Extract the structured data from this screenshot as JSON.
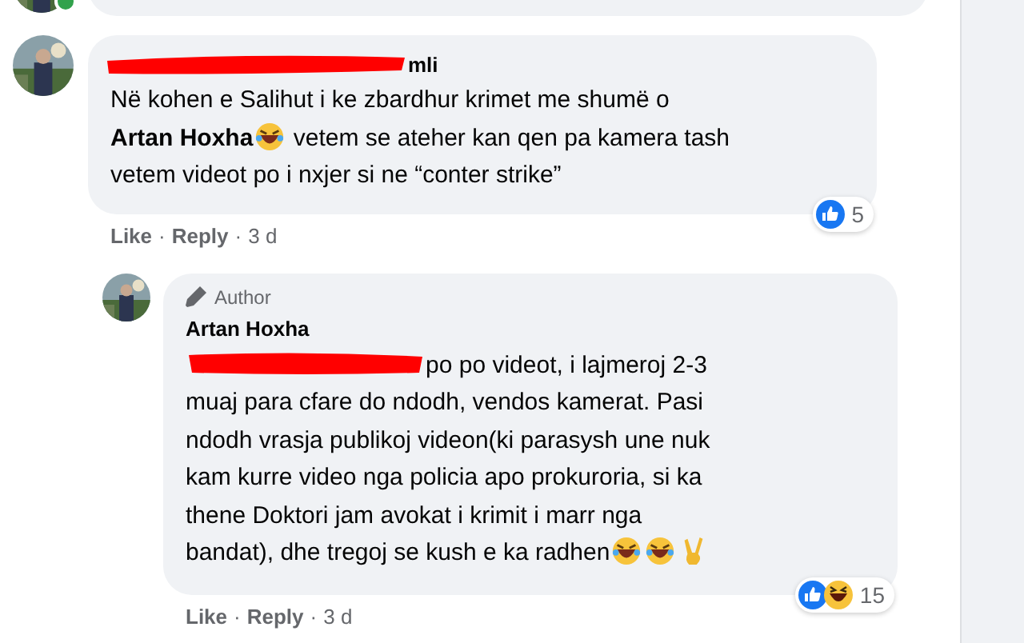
{
  "previous_comment": {
    "avatar": {
      "kind": "picture"
    },
    "online": true
  },
  "comments": [
    {
      "avatar": {
        "kind": "picture"
      },
      "name": "mli",
      "name_redacted": true,
      "lines": [
        [
          {
            "kind": "text",
            "text": "Në kohen e Salihut i ke zbardhur krimet me shumë o"
          }
        ],
        [
          {
            "kind": "text",
            "text": "**Artan Hoxha**"
          },
          {
            "kind": "laugh"
          },
          {
            "kind": "text",
            "text": " vetem se ateher kan qen pa kamera tash"
          }
        ],
        [
          {
            "kind": "text",
            "text": "vetem videot po i nxjer si ne “conter strike”"
          }
        ]
      ],
      "reactions": [
        {
          "kind": "like"
        }
      ],
      "reaction_count": "5",
      "actions": [
        "Like",
        "Reply"
      ],
      "separator": "·",
      "time": "3 d",
      "reply": false
    },
    {
      "avatar": {
        "kind": "picture"
      },
      "author_badge": "Author",
      "name": "Artan Hoxha",
      "name_redacted": false,
      "lines": [
        [
          {
            "kind": "redaction"
          },
          {
            "kind": "text",
            "text": "po po videot, i lajmeroj 2-3"
          }
        ],
        [
          {
            "kind": "text",
            "text": "muaj para cfare do ndodh, vendos kamerat. Pasi"
          }
        ],
        [
          {
            "kind": "text",
            "text": "ndodh vrasja publikoj videon(ki parasysh une nuk"
          }
        ],
        [
          {
            "kind": "text",
            "text": "kam kurre video nga policia apo prokuroria, si ka"
          }
        ],
        [
          {
            "kind": "text",
            "text": "thene Doktori jam avokat i krimit i marr nga"
          }
        ],
        [
          {
            "kind": "text",
            "text": "bandat), dhe tregoj se kush e ka radhen"
          },
          {
            "kind": "laugh"
          },
          {
            "kind": "laugh"
          },
          {
            "kind": "victory"
          }
        ]
      ],
      "reactions": [
        {
          "kind": "like"
        },
        {
          "kind": "haha"
        }
      ],
      "reaction_count": "15",
      "actions": [
        "Like",
        "Reply"
      ],
      "separator": "·",
      "time": "3 d",
      "reply": true
    }
  ]
}
